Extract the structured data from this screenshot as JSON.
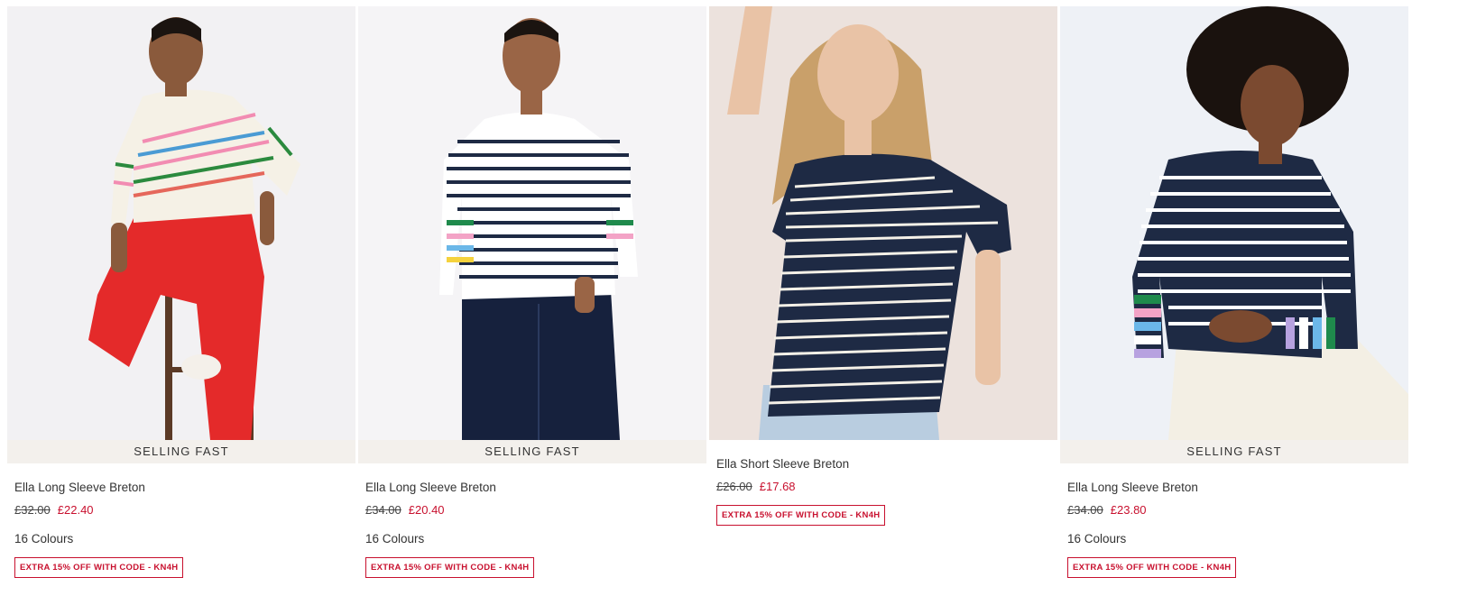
{
  "products": [
    {
      "badge": "SELLING FAST",
      "name": "Ella Long Sleeve Breton",
      "old_price": "£32.00",
      "new_price": "£22.40",
      "colours": "16 Colours",
      "promo": "EXTRA 15% OFF WITH CODE - KN4H"
    },
    {
      "badge": "SELLING FAST",
      "name": "Ella Long Sleeve Breton",
      "old_price": "£34.00",
      "new_price": "£20.40",
      "colours": "16 Colours",
      "promo": "EXTRA 15% OFF WITH CODE - KN4H"
    },
    {
      "name": "Ella Short Sleeve Breton",
      "old_price": "£26.00",
      "new_price": "£17.68",
      "promo": "EXTRA 15% OFF WITH CODE - KN4H"
    },
    {
      "badge": "SELLING FAST",
      "name": "Ella Long Sleeve Breton",
      "old_price": "£34.00",
      "new_price": "£23.80",
      "colours": "16 Colours",
      "promo": "EXTRA 15% OFF WITH CODE - KN4H"
    }
  ],
  "colors": {
    "sale_red": "#c8102e",
    "badge_bg": "#f3f0ec",
    "navy": "#1e2a44"
  }
}
